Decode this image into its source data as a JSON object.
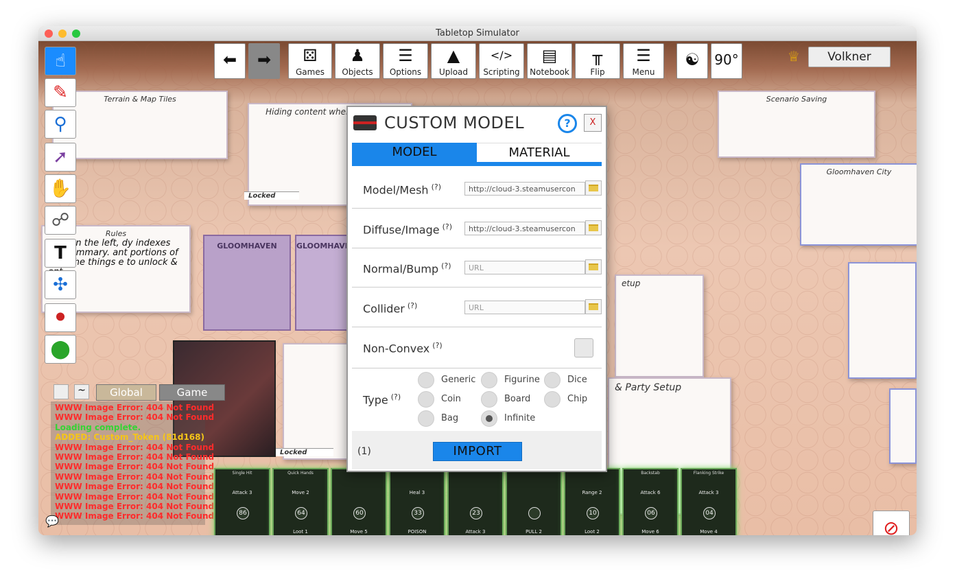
{
  "window": {
    "title": "Tabletop Simulator"
  },
  "toolbar": {
    "back_icon": "arrow-left-icon",
    "forward_icon": "arrow-right-icon",
    "games": "Games",
    "objects": "Objects",
    "options": "Options",
    "upload": "Upload",
    "scripting": "Scripting",
    "notebook": "Notebook",
    "flip": "Flip",
    "menu": "Menu",
    "rotation": "90°"
  },
  "player": {
    "name": "Volkner",
    "crown_icon": "crown-icon"
  },
  "sidebar": [
    "pointer-icon",
    "pen-icon",
    "location-pin-icon",
    "line-tool-icon",
    "grab-hand-icon",
    "joint-chain-icon",
    "text-tool-icon",
    "gizmo-axes-icon",
    "stamp-icon",
    "green-ball-icon"
  ],
  "chat": {
    "tab_global": "Global",
    "tab_game": "Game",
    "tilde": "~",
    "lines": [
      {
        "text": "WWW Image Error: 404 Not Found",
        "color": "#ff2b2b"
      },
      {
        "text": "WWW Image Error: 404 Not Found",
        "color": "#ff2b2b"
      },
      {
        "text": "Loading complete.",
        "color": "#35d435"
      },
      {
        "text": "ADDED: Custom_Token (81d168)",
        "color": "#f5c518"
      },
      {
        "text": "WWW Image Error: 404 Not Found",
        "color": "#ff2b2b"
      },
      {
        "text": "WWW Image Error: 404 Not Found",
        "color": "#ff2b2b"
      },
      {
        "text": "WWW Image Error: 404 Not Found",
        "color": "#ff2b2b"
      },
      {
        "text": "WWW Image Error: 404 Not Found",
        "color": "#ff2b2b"
      },
      {
        "text": "WWW Image Error: 404 Not Found",
        "color": "#ff2b2b"
      },
      {
        "text": "WWW Image Error: 404 Not Found",
        "color": "#ff2b2b"
      },
      {
        "text": "WWW Image Error: 404 Not Found",
        "color": "#ff2b2b"
      },
      {
        "text": "WWW Image Error: 404 Not Found",
        "color": "#ff2b2b"
      }
    ]
  },
  "board_panels": {
    "terrain": "Terrain & Map Tiles",
    "hiding": "Hiding content when not in use",
    "rules": "Rules",
    "scenario_saving": "Scenario Saving",
    "gloomhaven_city": "Gloomhaven City",
    "locked": "Locked",
    "setup": "etup",
    "party_setup": "& Party Setup",
    "rules_text": "o be on the left, dy indexes and a mmary. ant portions of st of the things e to unlock & ent.",
    "gloom_book": "GLOOMHAVEN"
  },
  "modal": {
    "title": "CUSTOM MODEL",
    "help_icon": "question-circle-icon",
    "close": "X",
    "tab_model": "MODEL",
    "tab_material": "MATERIAL",
    "fields": [
      {
        "label": "Model/Mesh",
        "hint": "(?)",
        "value": "http://cloud-3.steamusercon",
        "placeholder": ""
      },
      {
        "label": "Diffuse/Image",
        "hint": "(?)",
        "value": "http://cloud-3.steamusercon",
        "placeholder": ""
      },
      {
        "label": "Normal/Bump",
        "hint": "(?)",
        "value": "",
        "placeholder": "URL"
      },
      {
        "label": "Collider",
        "hint": "(?)",
        "value": "",
        "placeholder": "URL"
      }
    ],
    "nonconvex": {
      "label": "Non-Convex",
      "hint": "(?)",
      "checked": false
    },
    "type": {
      "label": "Type",
      "hint": "(?)",
      "selected": "Infinite",
      "options": [
        "Generic",
        "Figurine",
        "Dice",
        "Coin",
        "Board",
        "Chip",
        "Bag",
        "Infinite"
      ]
    },
    "count": "(1)",
    "import": "IMPORT"
  },
  "cards": [
    {
      "title": "Single Hit",
      "top": "Attack 3",
      "num": "86",
      "bottom": ""
    },
    {
      "title": "Quick Hands",
      "top": "Move 2",
      "num": "64",
      "bottom": "Loot 1"
    },
    {
      "title": "",
      "top": "",
      "num": "60",
      "bottom": "Move 5"
    },
    {
      "title": "",
      "top": "Heal 3",
      "num": "33",
      "bottom": "POISON"
    },
    {
      "title": "",
      "top": "",
      "num": "23",
      "bottom": "Attack 3"
    },
    {
      "title": "",
      "top": "",
      "num": "",
      "bottom": "PULL 2"
    },
    {
      "title": "",
      "top": "Range 2",
      "num": "10",
      "bottom": "Loot 2"
    },
    {
      "title": "Backstab",
      "top": "Attack 6",
      "num": "06",
      "bottom": "Move 6"
    },
    {
      "title": "Flanking Strike",
      "top": "Attack 3",
      "num": "04",
      "bottom": "Move 4"
    }
  ],
  "corner_icon": "no-draw-icon",
  "chat_bubble_icon": "speech-bubble-icon"
}
